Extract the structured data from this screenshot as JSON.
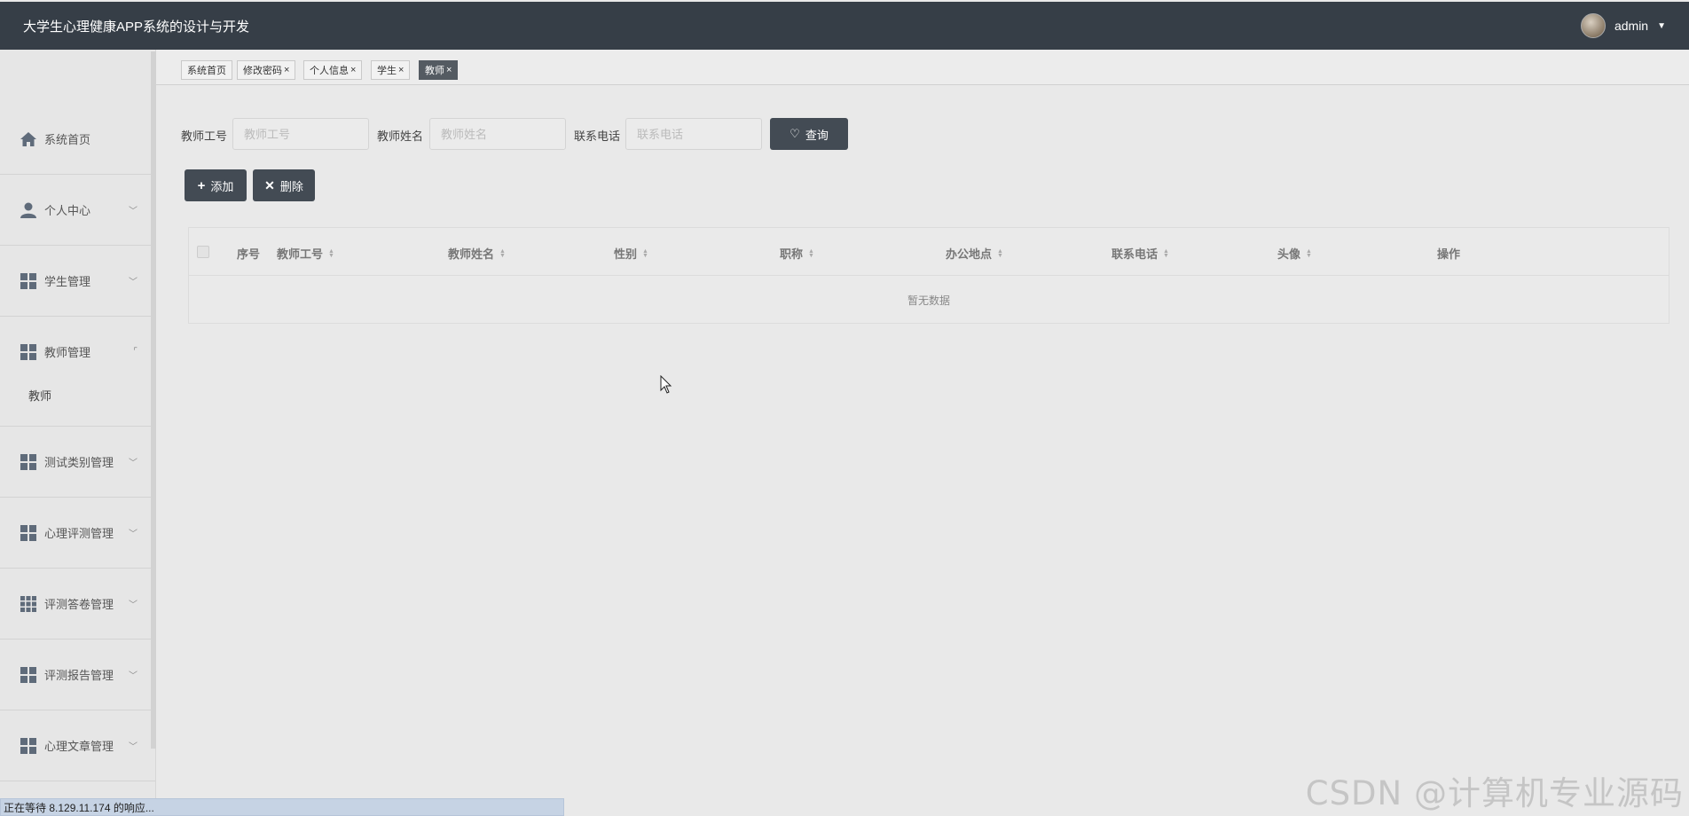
{
  "header": {
    "title": "大学生心理健康APP系统的设计与开发",
    "username": "admin"
  },
  "sidebar": {
    "items": [
      {
        "label": "系统首页",
        "icon": "home-icon"
      },
      {
        "label": "个人中心",
        "icon": "user-icon"
      },
      {
        "label": "学生管理",
        "icon": "grid-icon"
      },
      {
        "label": "教师管理",
        "icon": "grid-icon",
        "submenu": [
          "教师"
        ]
      },
      {
        "label": "测试类别管理",
        "icon": "grid-icon"
      },
      {
        "label": "心理评测管理",
        "icon": "grid-icon"
      },
      {
        "label": "评测答卷管理",
        "icon": "table-grid-icon"
      },
      {
        "label": "评测报告管理",
        "icon": "grid-icon"
      },
      {
        "label": "心理文章管理",
        "icon": "grid-icon"
      }
    ]
  },
  "tabs": [
    {
      "label": "系统首页",
      "closable": false
    },
    {
      "label": "修改密码",
      "closable": true
    },
    {
      "label": "个人信息",
      "closable": true
    },
    {
      "label": "学生",
      "closable": true
    },
    {
      "label": "教师",
      "closable": true,
      "active": true
    }
  ],
  "search": {
    "fields": [
      {
        "label": "教师工号",
        "placeholder": "教师工号"
      },
      {
        "label": "教师姓名",
        "placeholder": "教师姓名"
      },
      {
        "label": "联系电话",
        "placeholder": "联系电话"
      }
    ],
    "query_label": "查询"
  },
  "actions": {
    "add_label": "添加",
    "delete_label": "删除"
  },
  "table": {
    "columns": [
      "序号",
      "教师工号",
      "教师姓名",
      "性别",
      "职称",
      "办公地点",
      "联系电话",
      "头像",
      "操作"
    ],
    "empty_text": "暂无数据"
  },
  "statusbar": {
    "text": "正在等待 8.129.11.174 的响应..."
  },
  "watermark": {
    "text": "CSDN @计算机专业源码"
  },
  "colors": {
    "header_bg": "#363e47",
    "primary_button": "#434b54",
    "active_tab": "#545b62",
    "body_bg": "#e9e9e9"
  }
}
